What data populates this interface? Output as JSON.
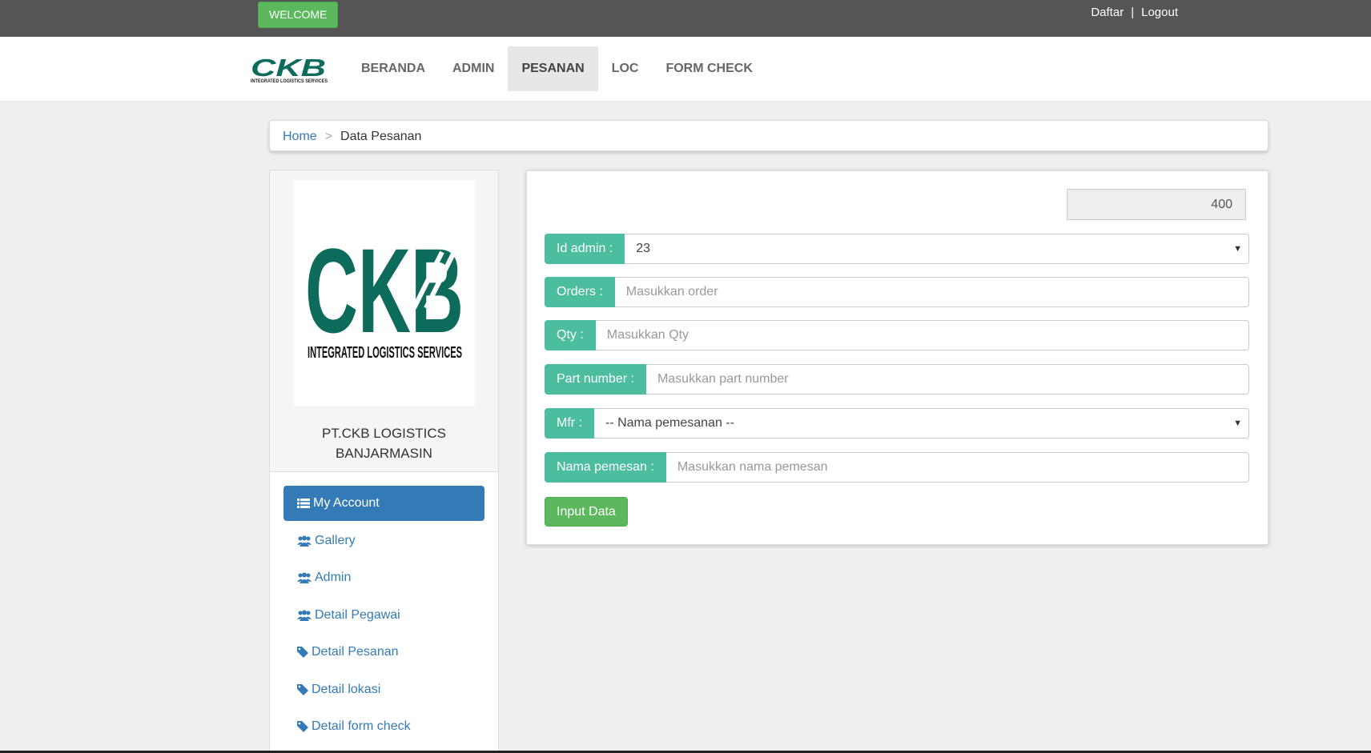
{
  "topbar": {
    "welcome_label": "WELCOME",
    "daftar_label": "Daftar",
    "separator": "|",
    "logout_label": "Logout"
  },
  "nav": {
    "logo_text": "CKB",
    "logo_subtext": "INTEGRATED LOGISTICS SERVICES",
    "items": [
      {
        "label": "BERANDA"
      },
      {
        "label": "ADMIN"
      },
      {
        "label": "PESANAN"
      },
      {
        "label": "LOC"
      },
      {
        "label": "FORM CHECK"
      }
    ],
    "active": "PESANAN"
  },
  "breadcrumb": {
    "home": "Home",
    "separator": ">",
    "current": "Data Pesanan"
  },
  "sidebar": {
    "logo_text": "CKB",
    "logo_subtext": "INTEGRATED LOGISTICS SERVICES",
    "company_line1": "PT.CKB LOGISTICS",
    "company_line2": "BANJARMASIN",
    "menu": [
      {
        "label": "My Account",
        "icon": "list-icon"
      },
      {
        "label": "Gallery",
        "icon": "users-icon"
      },
      {
        "label": "Admin",
        "icon": "users-icon"
      },
      {
        "label": "Detail Pegawai",
        "icon": "users-icon"
      },
      {
        "label": "Detail Pesanan",
        "icon": "tag-icon"
      },
      {
        "label": "Detail lokasi",
        "icon": "tag-icon"
      },
      {
        "label": "Detail form check",
        "icon": "tag-icon"
      }
    ]
  },
  "form": {
    "total_value": "400",
    "id_admin": {
      "label": "Id admin :",
      "value": "23"
    },
    "orders": {
      "label": "Orders :",
      "placeholder": "Masukkan order"
    },
    "qty": {
      "label": "Qty :",
      "placeholder": "Masukkan Qty"
    },
    "part_number": {
      "label": "Part number :",
      "placeholder": "Masukkan part number"
    },
    "mfr": {
      "label": "Mfr :",
      "value": "-- Nama pemesanan --"
    },
    "nama_pemesan": {
      "label": "Nama pemesan :",
      "placeholder": "Masukkan nama pemesan"
    },
    "submit_label": "Input Data"
  },
  "colors": {
    "topbar": "#555555",
    "brand_green": "#0c6b5b",
    "label_teal": "#4dbda0",
    "primary_blue": "#337ab7",
    "success_green": "#5cb85c"
  }
}
